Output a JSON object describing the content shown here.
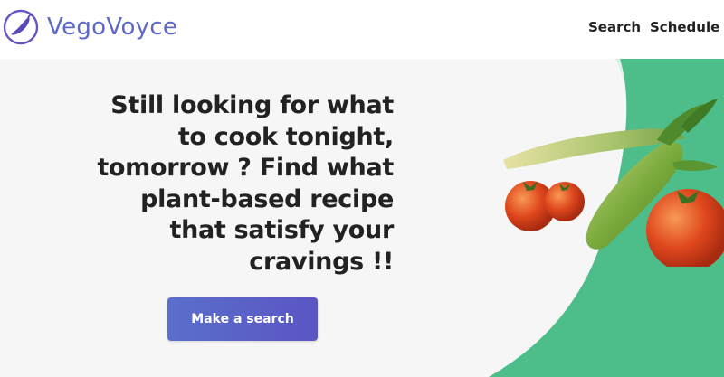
{
  "header": {
    "brand": "VegoVoyce",
    "nav": {
      "search_label": "Search",
      "schedule_label": "Schedule"
    }
  },
  "hero": {
    "lines": [
      "Still looking for what",
      "to cook tonight,",
      "tomorrow ? Find what",
      "plant-based recipe",
      "that satisfy your",
      "cravings !!"
    ],
    "cta_label": "Make a search"
  },
  "colors": {
    "accent": "#5e68c8",
    "green": "#4dbd8a",
    "mint": "#d9f3e6",
    "background": "#f6f6f6"
  },
  "icons": {
    "logo": "chili-pepper-icon"
  }
}
